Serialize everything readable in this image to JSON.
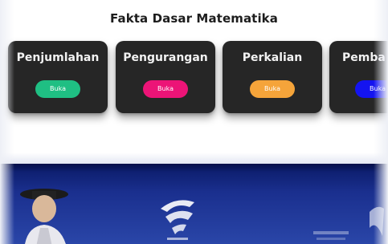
{
  "section": {
    "title": "Fakta Dasar Matematika"
  },
  "cards": [
    {
      "title": "Penjumlahan",
      "button_label": "Buka",
      "button_color": "#1fbf83"
    },
    {
      "title": "Pengurangan",
      "button_label": "Buka",
      "button_color": "#ec1477"
    },
    {
      "title": "Perkalian",
      "button_label": "Buka",
      "button_color": "#f5a43a"
    },
    {
      "title": "Pemba",
      "button_label": "Buka",
      "button_color": "#1414f0"
    }
  ],
  "colors": {
    "card_bg": "#262626",
    "banner_bg": "#1a2f8e"
  },
  "banner": {
    "logo": "university-logo-icon",
    "photo": "graduate-photo"
  }
}
